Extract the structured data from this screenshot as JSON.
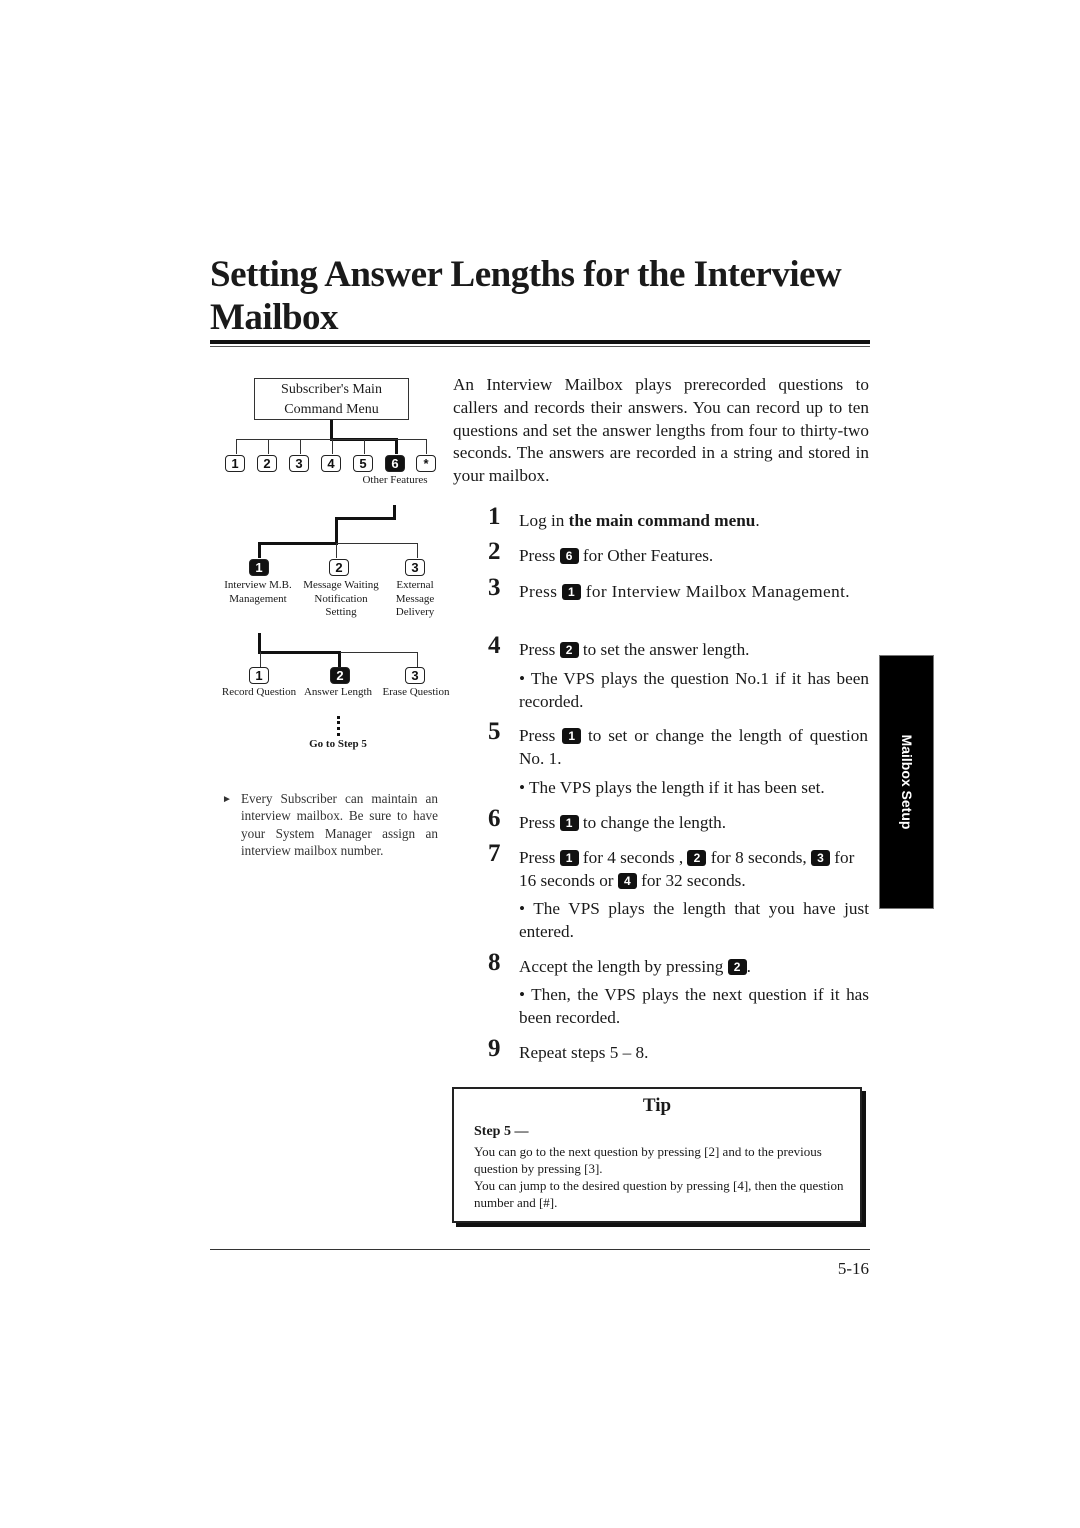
{
  "page": {
    "title": "Setting Answer Lengths for the Interview Mailbox",
    "page_number": "5-16",
    "side_tab": "Mailbox Setup"
  },
  "diagram": {
    "root": "Subscriber's Main Command Menu",
    "level1_keys": [
      "1",
      "2",
      "3",
      "4",
      "5",
      "6",
      "*"
    ],
    "level1_selected": "6",
    "level1_label": "Other Features",
    "level2": [
      {
        "key": "1",
        "label": "Interview M.B. Management",
        "selected": true
      },
      {
        "key": "2",
        "label": "Message Waiting Notification Setting",
        "selected": false
      },
      {
        "key": "3",
        "label": "External Message Delivery",
        "selected": false
      }
    ],
    "level3": [
      {
        "key": "1",
        "label": "Record Question",
        "selected": false
      },
      {
        "key": "2",
        "label": "Answer Length",
        "selected": true
      },
      {
        "key": "3",
        "label": "Erase Question",
        "selected": false
      }
    ],
    "goto": "Go to Step 5"
  },
  "note": "Every Subscriber can maintain an interview mailbox. Be sure to have your System Manager assign an interview mailbox number.",
  "intro": "An Interview Mailbox plays prerecorded questions to callers and records their answers. You can record up to ten questions and set the answer lengths from four to thirty-two seconds. The answers are recorded in a string and stored in your mailbox.",
  "steps": [
    {
      "n": "1",
      "pre": "Log in ",
      "bold": "the main command menu",
      "post": "."
    },
    {
      "n": "2",
      "pre": "Press ",
      "key": "6",
      "post": " for Other Features."
    },
    {
      "n": "3",
      "pre": "Press ",
      "key": "1",
      "post": " for Interview Mailbox Management."
    },
    {
      "n": "4",
      "pre": "Press ",
      "key": "2",
      "post": " to set the answer length.",
      "bullet": "The VPS plays the question No.1 if it has been recorded."
    },
    {
      "n": "5",
      "pre": "Press ",
      "key": "1",
      "post": " to set or change the length of question No. 1.",
      "bullet": "The VPS plays the length if it has been set."
    },
    {
      "n": "6",
      "pre": "Press ",
      "key": "1",
      "post": " to change the length."
    },
    {
      "n": "7",
      "k1": "1",
      "t1": " for 4 seconds , ",
      "k2": "2",
      "t2": " for 8 seconds, ",
      "k3": "3",
      "t3": " for 16 seconds or ",
      "k4": "4",
      "t4": " for 32 seconds.",
      "pre": "Press ",
      "bullet": "The VPS plays the length that you have just entered."
    },
    {
      "n": "8",
      "pre": "Accept the length by pressing ",
      "key": "2",
      "post": ".",
      "bullet": "Then, the VPS plays the next question if it has been recorded."
    },
    {
      "n": "9",
      "pre": "Repeat steps 5 – 8."
    }
  ],
  "tip": {
    "title": "Tip",
    "step": "Step 5 —",
    "line1": "You can go to the next question by pressing [2] and to the previous question by pressing [3].",
    "line2": "You can jump to the desired question by pressing [4], then the question number and [#]."
  }
}
